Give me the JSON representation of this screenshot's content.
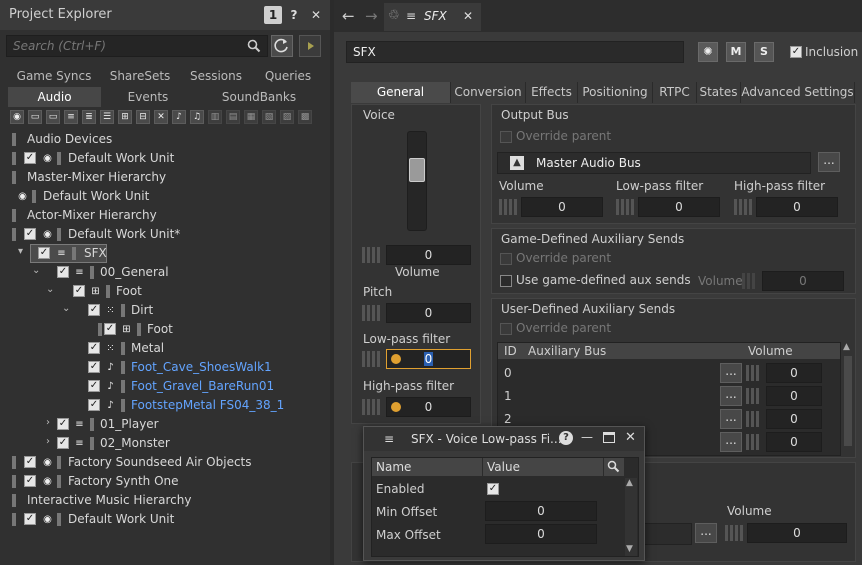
{
  "explorer": {
    "title": "Project Explorer",
    "badge": "1",
    "help": "?",
    "close": "✕",
    "search_placeholder": "Search (Ctrl+F)",
    "tabs_row1": [
      "Game Syncs",
      "ShareSets",
      "Sessions",
      "Queries"
    ],
    "tabs_row2": [
      "Audio",
      "Events",
      "SoundBanks"
    ],
    "selected_tab": "Audio",
    "tree": [
      {
        "label": "Audio Devices"
      },
      {
        "label": "Default Work Unit"
      },
      {
        "label": "Master-Mixer Hierarchy"
      },
      {
        "label": "Default Work Unit"
      },
      {
        "label": "Actor-Mixer Hierarchy"
      },
      {
        "label": "Default Work Unit*"
      },
      {
        "label": "SFX"
      },
      {
        "label": "00_General"
      },
      {
        "label": "Foot"
      },
      {
        "label": "Dirt"
      },
      {
        "label": "Foot"
      },
      {
        "label": "Metal"
      },
      {
        "label": "Foot_Cave_ShoesWalk1"
      },
      {
        "label": "Foot_Gravel_BareRun01"
      },
      {
        "label": "FootstepMetal FS04_38_1"
      },
      {
        "label": "01_Player"
      },
      {
        "label": "02_Monster"
      },
      {
        "label": "Factory Soundseed Air Objects"
      },
      {
        "label": "Factory Synth One"
      },
      {
        "label": "Interactive Music Hierarchy"
      },
      {
        "label": "Default Work Unit"
      }
    ]
  },
  "editor": {
    "doc_tab": "SFX",
    "name_value": "SFX",
    "mute_label": "M",
    "solo_label": "S",
    "inclusion_label": "Inclusion",
    "tabs": [
      "General Settings",
      "Conversion",
      "Effects",
      "Positioning",
      "RTPC",
      "States",
      "Advanced Settings"
    ],
    "voice": {
      "title": "Voice",
      "volume_label": "Volume",
      "volume_value": "0",
      "pitch_label": "Pitch",
      "pitch_value": "0",
      "lowpass_label": "Low-pass filter",
      "lowpass_value": "0",
      "highpass_label": "High-pass filter",
      "highpass_value": "0"
    },
    "output_bus": {
      "title": "Output Bus",
      "override_label": "Override parent",
      "bus_name": "Master Audio Bus",
      "volume_label": "Volume",
      "volume_value": "0",
      "lpf_label": "Low-pass filter",
      "lpf_value": "0",
      "hpf_label": "High-pass filter",
      "hpf_value": "0"
    },
    "game_aux": {
      "title": "Game-Defined Auxiliary Sends",
      "override_label": "Override parent",
      "use_label": "Use game-defined aux sends",
      "volume_label": "Volume",
      "volume_value": "0"
    },
    "user_aux": {
      "title": "User-Defined Auxiliary Sends",
      "override_label": "Override parent",
      "headers": [
        "ID",
        "Auxiliary Bus",
        "Volume"
      ],
      "rows": [
        {
          "id": "0",
          "volume": "0"
        },
        {
          "id": "1",
          "volume": "0"
        },
        {
          "id": "2",
          "volume": "0"
        },
        {
          "id": "",
          "volume": "0"
        }
      ]
    },
    "bottom": {
      "volume_label": "Volume",
      "volume_value": "0"
    }
  },
  "lowpass_window": {
    "title": "SFX - Voice Low-pass Fi...",
    "headers": [
      "Name",
      "Value"
    ],
    "rows": [
      {
        "name": "Enabled",
        "value": "✓"
      },
      {
        "name": "Min Offset",
        "value": "0"
      },
      {
        "name": "Max Offset",
        "value": "0"
      }
    ]
  }
}
